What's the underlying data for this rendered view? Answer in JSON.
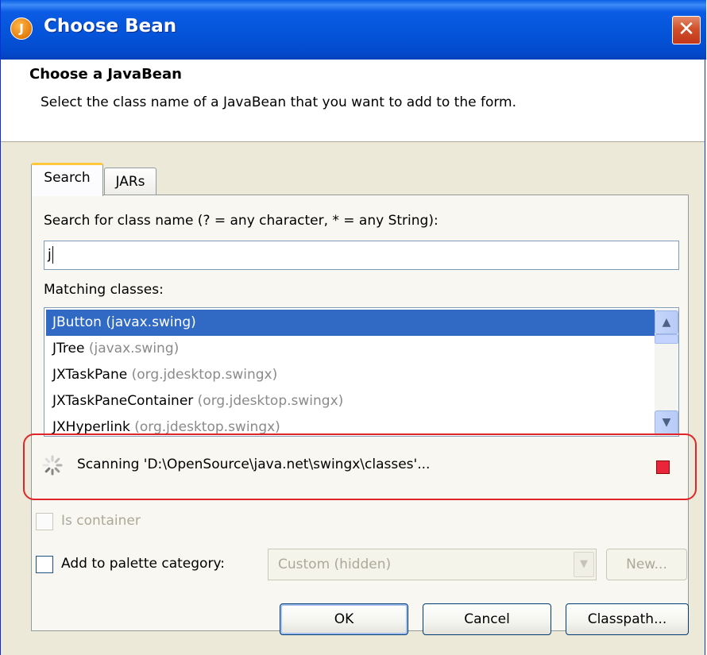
{
  "window": {
    "title": "Choose Bean",
    "icon": "java-app-icon",
    "close_label": "✕"
  },
  "header": {
    "title": "Choose a JavaBean",
    "description": "Select the class name of a JavaBean that you want to add to the form."
  },
  "tabs": [
    {
      "label": "Search",
      "mnemonic": "e",
      "selected": true
    },
    {
      "label": "JARs",
      "mnemonic": "J",
      "selected": false
    }
  ],
  "search": {
    "label": "Search for class name (? = any character, * = any String):",
    "value": "j"
  },
  "matching": {
    "label": "Matching classes:",
    "items": [
      {
        "name": "JButton",
        "package": "(javax.swing)",
        "selected": true
      },
      {
        "name": "JTree",
        "package": "(javax.swing)",
        "selected": false
      },
      {
        "name": "JXTaskPane",
        "package": "(org.jdesktop.swingx)",
        "selected": false
      },
      {
        "name": "JXTaskPaneContainer",
        "package": "(org.jdesktop.swingx)",
        "selected": false
      },
      {
        "name": "JXHyperlink",
        "package": "(org.jdesktop.swingx)",
        "selected": false
      }
    ]
  },
  "status": {
    "text": "Scanning 'D:\\OpenSource\\java.net\\swingx\\classes'...",
    "spinner_icon": "spinner-icon",
    "stop_icon": "stop-icon",
    "highlight_color": "#e0242a"
  },
  "options": {
    "is_container_label": "Is container",
    "is_container_checked": false,
    "is_container_enabled": false,
    "add_to_palette_label": "Add to palette category:",
    "add_to_palette_checked": false,
    "palette_category_value": "Custom (hidden)",
    "new_label": "New..."
  },
  "buttons": {
    "ok": "OK",
    "cancel": "Cancel",
    "classpath": "Classpath..."
  },
  "colors": {
    "title_bar": "#0453d8",
    "selection": "#316ac5",
    "dialog_bg": "#ece9d8"
  }
}
